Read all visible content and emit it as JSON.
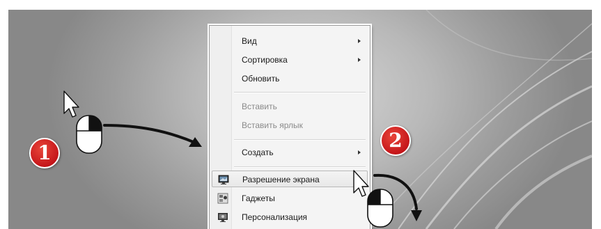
{
  "context_menu": {
    "items": [
      {
        "label": "Вид",
        "submenu": true,
        "enabled": true
      },
      {
        "label": "Сортировка",
        "submenu": true,
        "enabled": true
      },
      {
        "label": "Обновить",
        "submenu": false,
        "enabled": true
      },
      {
        "label": "Вставить",
        "submenu": false,
        "enabled": false
      },
      {
        "label": "Вставить ярлык",
        "submenu": false,
        "enabled": false
      },
      {
        "label": "Создать",
        "submenu": true,
        "enabled": true
      },
      {
        "label": "Разрешение экрана",
        "submenu": false,
        "enabled": true,
        "highlighted": true,
        "icon": "screen-resolution-icon"
      },
      {
        "label": "Гаджеты",
        "submenu": false,
        "enabled": true,
        "icon": "gadgets-icon"
      },
      {
        "label": "Персонализация",
        "submenu": false,
        "enabled": true,
        "icon": "personalization-icon"
      }
    ]
  },
  "steps": [
    {
      "number": "1",
      "action": "right-click"
    },
    {
      "number": "2",
      "action": "left-click"
    }
  ],
  "colors": {
    "badge": "#c5161a",
    "menu_background": "#f4f4f4",
    "disabled_text": "#8a8a8a"
  }
}
